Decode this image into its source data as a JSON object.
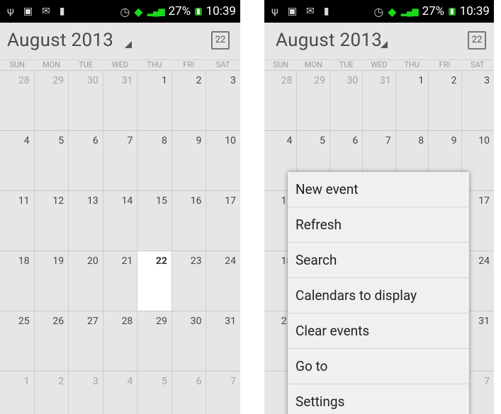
{
  "status_bar": {
    "battery": "27%",
    "time": "10:39",
    "icons": [
      "usb-icon",
      "gallery-icon",
      "mail-icon",
      "notification-icon",
      "alarm-icon",
      "wifi-icon",
      "signal-icon"
    ]
  },
  "calendar": {
    "title": "August 2013",
    "today_button": "22",
    "weekdays": [
      "SUN",
      "MON",
      "TUE",
      "WED",
      "THU",
      "FRI",
      "SAT"
    ],
    "weeks": [
      [
        "28",
        "29",
        "30",
        "31",
        "1",
        "2",
        "3"
      ],
      [
        "4",
        "5",
        "6",
        "7",
        "8",
        "9",
        "10"
      ],
      [
        "11",
        "12",
        "13",
        "14",
        "15",
        "16",
        "17"
      ],
      [
        "18",
        "19",
        "20",
        "21",
        "22",
        "23",
        "24"
      ],
      [
        "25",
        "26",
        "27",
        "28",
        "29",
        "30",
        "31"
      ],
      [
        "1",
        "2",
        "3",
        "4",
        "5",
        "6",
        "7"
      ]
    ],
    "today": "22"
  },
  "menu": {
    "items": [
      "New event",
      "Refresh",
      "Search",
      "Calendars to display",
      "Clear events",
      "Go to",
      "Settings"
    ]
  },
  "colors": {
    "background": "#e6e6e6",
    "today_cell": "#ffffff",
    "status_bar": "#000000"
  }
}
